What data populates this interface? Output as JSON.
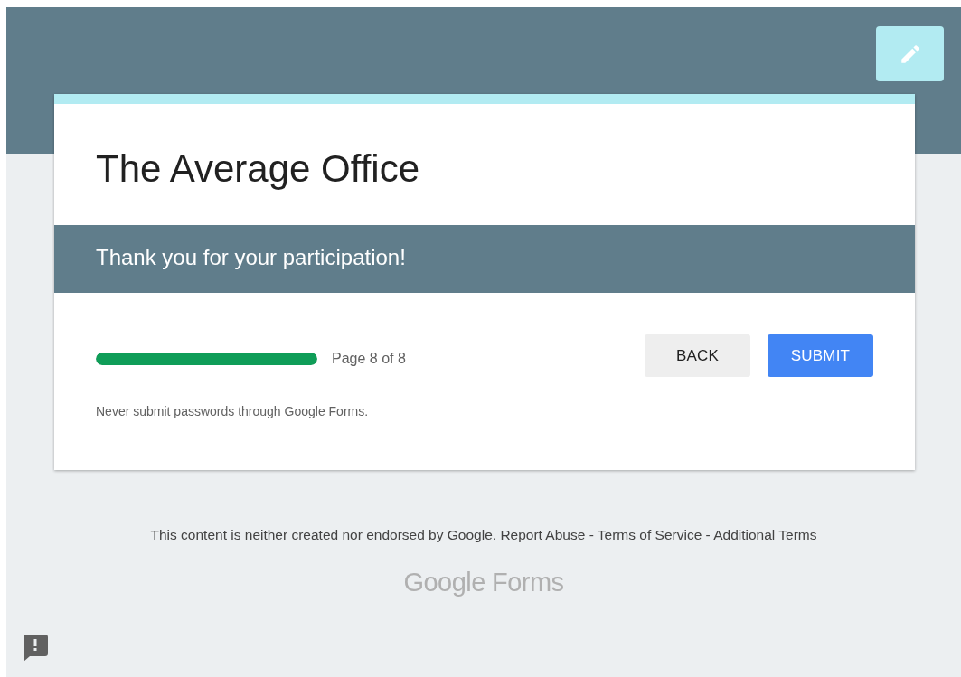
{
  "form": {
    "title": "The Average Office",
    "section_title": "Thank you for your participation!",
    "progress": {
      "level": 1,
      "label": "Page 8 of 8"
    },
    "buttons": [
      {
        "label": "BACK",
        "kind": "secondary"
      },
      {
        "label": "SUBMIT",
        "kind": "primary"
      }
    ],
    "note": "Never submit passwords through Google Forms."
  },
  "footer": {
    "disclaimer": "This content is neither created nor endorsed by Google.",
    "links": [
      "Report Abuse",
      "Terms of Service",
      "Additional Terms"
    ],
    "separator": "-"
  },
  "logo": {
    "brand": "Google",
    "product": "Forms"
  }
}
